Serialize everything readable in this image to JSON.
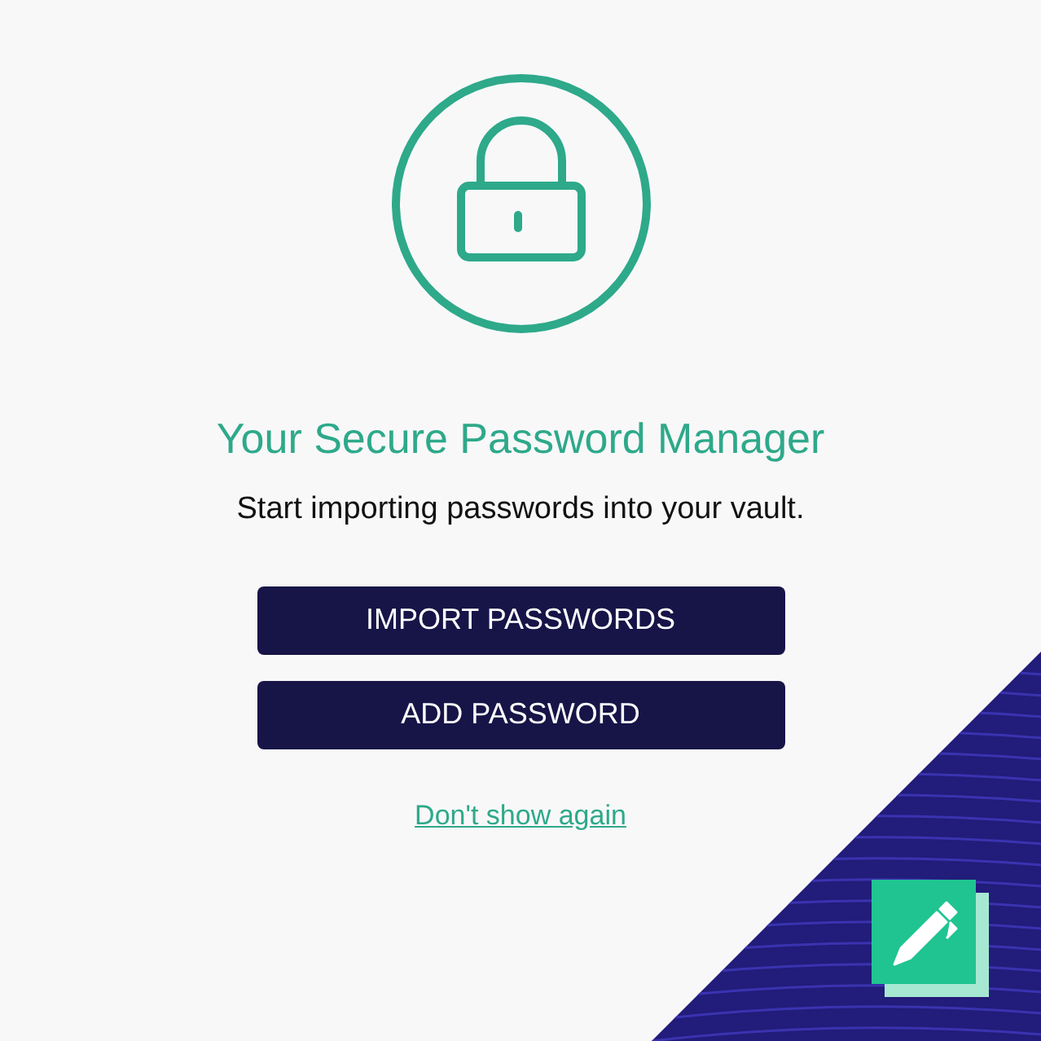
{
  "title": "Your Secure Password Manager",
  "subtitle": "Start importing passwords into your vault.",
  "buttons": [
    "IMPORT PASSWORDS",
    "ADD PASSWORD"
  ],
  "link": "Don't show again"
}
